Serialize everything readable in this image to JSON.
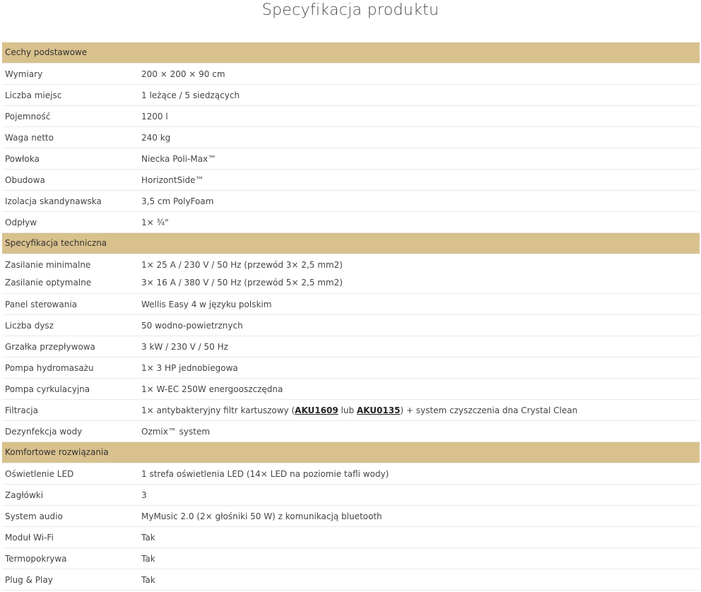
{
  "page_title": "Specyfikacja produktu",
  "sections": {
    "basic": {
      "title": "Cechy podstawowe",
      "rows": [
        {
          "label": "Wymiary",
          "value": "200 × 200 × 90 cm"
        },
        {
          "label": "Liczba miejsc",
          "value": "1 leżące / 5 siedzących"
        },
        {
          "label": "Pojemność",
          "value": "1200 l"
        },
        {
          "label": "Waga netto",
          "value": "240 kg"
        },
        {
          "label": "Powłoka",
          "value": "Niecka Poli-Max™"
        },
        {
          "label": "Obudowa",
          "value": "HorizontSide™"
        },
        {
          "label": "Izolacja skandynawska",
          "value": "3,5 cm PolyFoam"
        },
        {
          "label": "Odpływ",
          "value": "1× ¾\""
        }
      ]
    },
    "technical": {
      "title": "Specyfikacja techniczna",
      "power": {
        "label_min": "Zasilanie minimalne",
        "value_min": "1× 25 A / 230 V / 50 Hz (przewód 3× 2,5 mm2)",
        "label_opt": "Zasilanie optymalne",
        "value_opt": "3× 16 A / 380 V / 50 Hz (przewód 5× 2,5 mm2)"
      },
      "rows": [
        {
          "label": "Panel sterowania",
          "value": "Wellis Easy 4 w języku polskim"
        },
        {
          "label": "Liczba dysz",
          "value": "50 wodno-powietrznych"
        },
        {
          "label": "Grzałka przepływowa",
          "value": "3 kW / 230 V / 50 Hz"
        },
        {
          "label": "Pompa hydromasażu",
          "value": "1× 3 HP jednobiegowa"
        },
        {
          "label": "Pompa cyrkulacyjna",
          "value": "1× W-EC 250W energooszczędna"
        }
      ],
      "filtration": {
        "label": "Filtracja",
        "prefix": "1× antybakteryjny filtr kartuszowy (",
        "link1": "AKU1609",
        "middle": " lub ",
        "link2": "AKU0135",
        "suffix": ") + system czyszczenia dna Crystal Clean"
      },
      "disinfection": {
        "label": "Dezynfekcja wody",
        "value": "Ozmix™ system"
      }
    },
    "comfort": {
      "title": "Komfortowe rozwiązania",
      "rows": [
        {
          "label": "Oświetlenie LED",
          "value": "1 strefa oświetlenia LED (14× LED na poziomie tafli wody)"
        },
        {
          "label": "Zagłówki",
          "value": "3"
        },
        {
          "label": "System audio",
          "value": "MyMusic 2.0 (2× głośniki 50 W) z komunikacją bluetooth"
        },
        {
          "label": "Moduł Wi-Fi",
          "value": "Tak"
        },
        {
          "label": "Termopokrywa",
          "value": "Tak"
        },
        {
          "label": "Plug & Play",
          "value": "Tak"
        }
      ]
    }
  }
}
